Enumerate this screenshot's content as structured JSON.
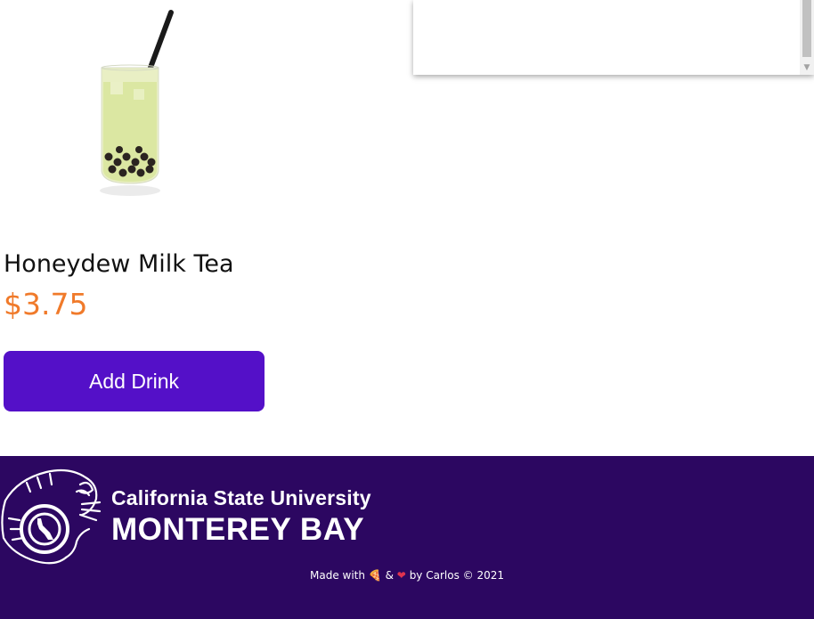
{
  "product": {
    "name": "Honeydew Milk Tea",
    "price": "$3.75",
    "image_icon": "honeydew-milk-tea-image"
  },
  "actions": {
    "add_label": "Add Drink"
  },
  "footer": {
    "university_line1": "California State University",
    "university_line2": "MONTEREY BAY",
    "credits": {
      "made_with": "Made with",
      "pizza_emoji": "🍕",
      "and": "&",
      "heart_emoji": "❤",
      "by_line": "by Carlos © 2021"
    }
  },
  "colors": {
    "price": "#f07a2a",
    "button": "#5410c8",
    "footer_bg": "#2c0761"
  }
}
